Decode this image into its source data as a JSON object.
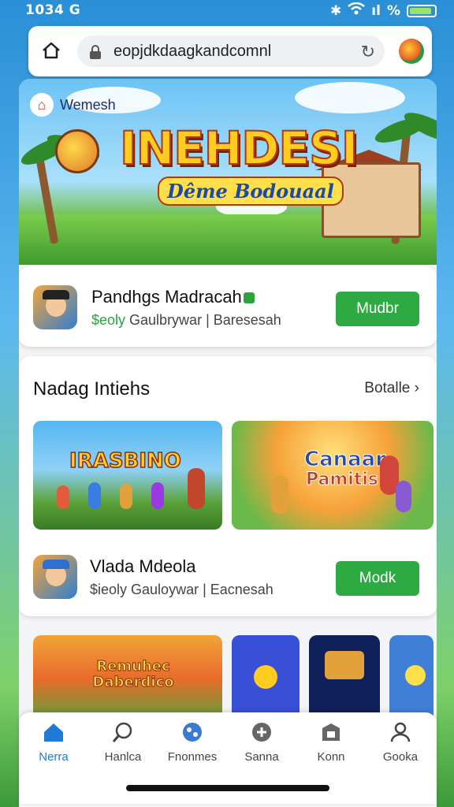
{
  "status_bar": {
    "time": "1034 G",
    "signal_text": "ıl",
    "battery_text": "%"
  },
  "browser": {
    "url": "eopjdkdaagkandcomnl"
  },
  "hero": {
    "brand": "Wemesh",
    "title": "INEHDESI",
    "subtitle": "Dême Bodouaal"
  },
  "featured_app": {
    "name": "Pandhgs Madracah",
    "sub_prefix": "$eoly",
    "sub_text": " Gaulbrywar | Baresesah",
    "button": "Mudbr"
  },
  "section": {
    "title": "Nadag Intiehs",
    "see_all": "Botalle",
    "thumb1_label": "IRASBINO",
    "thumb2_label_top": "Canaar",
    "thumb2_label_bottom": "Pamitis"
  },
  "second_app": {
    "name": "Vlada Mdeola",
    "sub_text": "$ieoly Gauloywar | Eacnesah",
    "button": "Modk"
  },
  "bottom_thumbs": {
    "thumb_label": "Remuhec Daberdico"
  },
  "nav": [
    {
      "label": "Nerra",
      "icon": "home-icon"
    },
    {
      "label": "Hanlca",
      "icon": "search-icon"
    },
    {
      "label": "Fnonmes",
      "icon": "games-icon"
    },
    {
      "label": "Sanna",
      "icon": "discover-icon"
    },
    {
      "label": "Konn",
      "icon": "library-icon"
    },
    {
      "label": "Gooka",
      "icon": "profile-icon"
    }
  ],
  "colors": {
    "accent_green": "#2eaa43",
    "accent_blue": "#1e7ad9"
  }
}
